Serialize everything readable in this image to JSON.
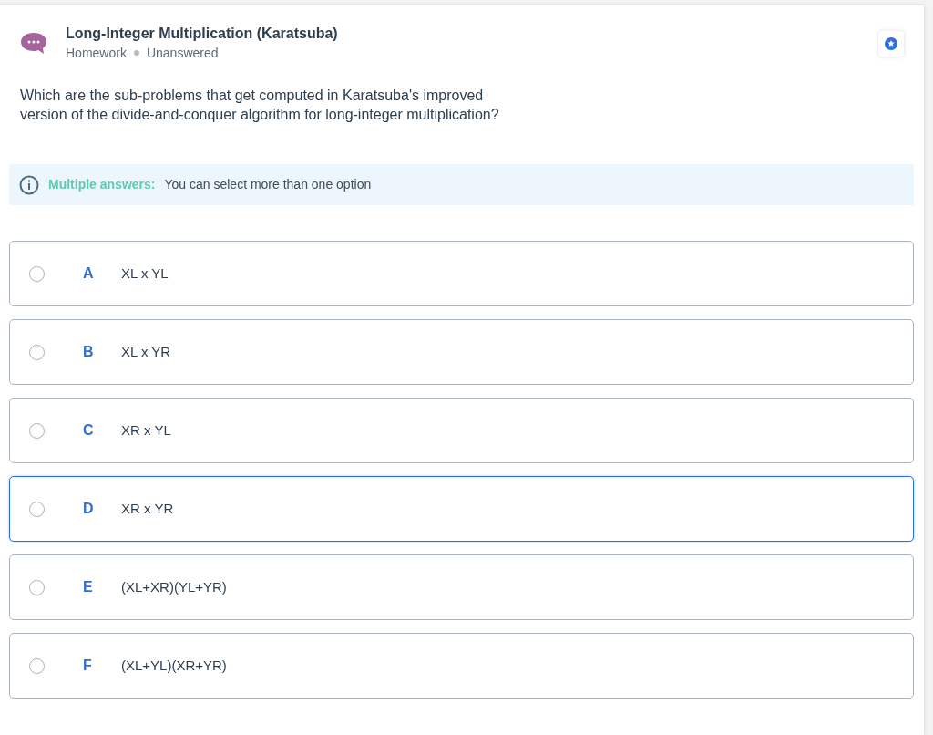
{
  "header": {
    "title": "Long-Integer Multiplication (Karatsuba)",
    "category": "Homework",
    "status": "Unanswered"
  },
  "question": "Which are the sub-problems that get computed in Karatsuba's improved version of the divide-and-conquer algorithm for long-integer multiplication?",
  "notice": {
    "label": "Multiple answers:",
    "text": "You can select more than one option"
  },
  "options": [
    {
      "letter": "A",
      "text": "XL x YL",
      "checked": false,
      "focused": false
    },
    {
      "letter": "B",
      "text": "XL x YR",
      "checked": false,
      "focused": false
    },
    {
      "letter": "C",
      "text": "XR x YL",
      "checked": false,
      "focused": false
    },
    {
      "letter": "D",
      "text": "XR x YR",
      "checked": false,
      "focused": true
    },
    {
      "letter": "E",
      "text": "(XL+XR)(YL+YR)",
      "checked": false,
      "focused": false
    },
    {
      "letter": "F",
      "text": "(XL+YL)(XR+YR)",
      "checked": false,
      "focused": false
    }
  ]
}
